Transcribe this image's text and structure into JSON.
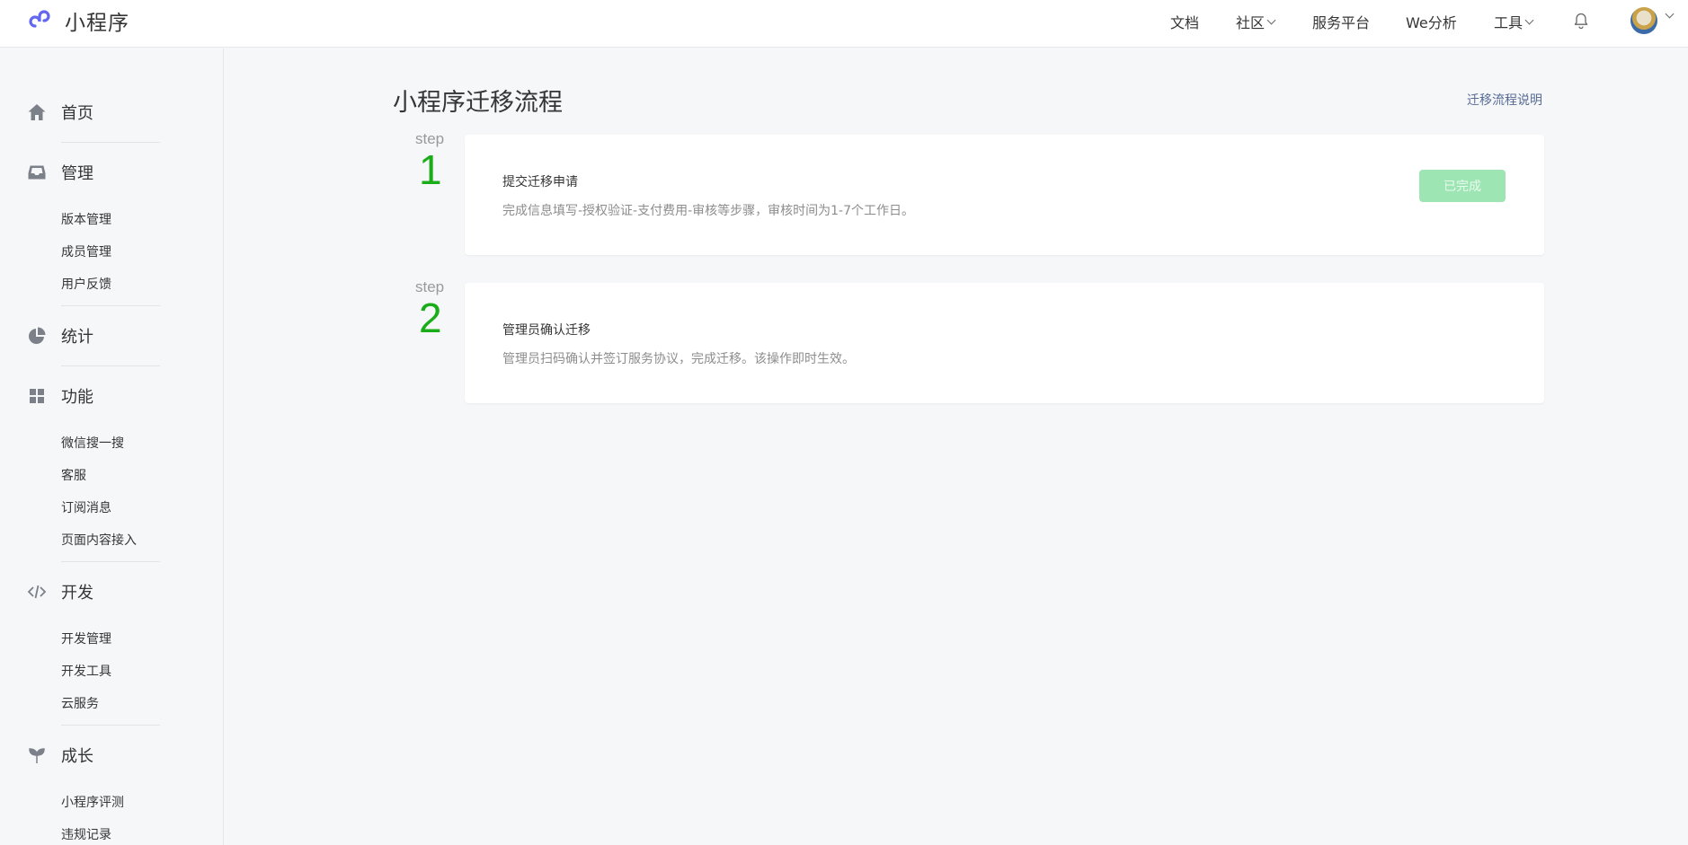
{
  "brand": {
    "name": "小程序"
  },
  "top_nav": {
    "items": [
      {
        "label": "文档",
        "has_dropdown": false
      },
      {
        "label": "社区",
        "has_dropdown": true
      },
      {
        "label": "服务平台",
        "has_dropdown": false
      },
      {
        "label": "We分析",
        "has_dropdown": false
      },
      {
        "label": "工具",
        "has_dropdown": true
      }
    ],
    "icons": [
      "bell-icon",
      "avatar"
    ]
  },
  "sidebar": {
    "groups": [
      {
        "label": "首页",
        "icon": "home-icon",
        "items": []
      },
      {
        "label": "管理",
        "icon": "inbox-icon",
        "items": [
          "版本管理",
          "成员管理",
          "用户反馈"
        ]
      },
      {
        "label": "统计",
        "icon": "pie-chart-icon",
        "items": []
      },
      {
        "label": "功能",
        "icon": "grid-icon",
        "items": [
          "微信搜一搜",
          "客服",
          "订阅消息",
          "页面内容接入"
        ]
      },
      {
        "label": "开发",
        "icon": "code-icon",
        "items": [
          "开发管理",
          "开发工具",
          "云服务"
        ]
      },
      {
        "label": "成长",
        "icon": "sprout-icon",
        "items": [
          "小程序评测",
          "违规记录"
        ]
      }
    ]
  },
  "main": {
    "title": "小程序迁移流程",
    "help_link": "迁移流程说明",
    "steps": [
      {
        "step_label": "step",
        "number": "1",
        "title": "提交迁移申请",
        "description": "完成信息填写-授权验证-支付费用-审核等步骤，审核时间为1-7个工作日。",
        "button_label": "已完成"
      },
      {
        "step_label": "step",
        "number": "2",
        "title": "管理员确认迁移",
        "description": "管理员扫码确认并签订服务协议，完成迁移。该操作即时生效。"
      }
    ]
  },
  "colors": {
    "accent_green": "#1aad19",
    "done_button_bg": "#9ee5b4",
    "link": "#576b95",
    "page_bg": "#f6f7f9"
  }
}
